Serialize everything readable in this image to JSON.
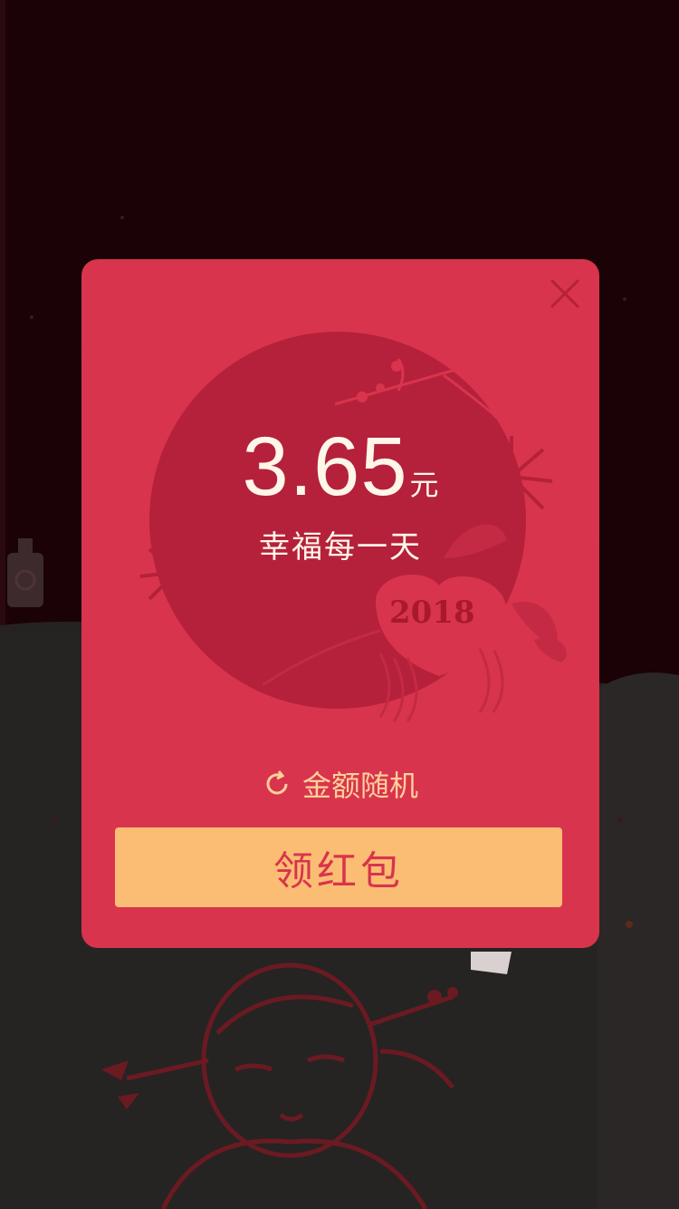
{
  "red_packet": {
    "amount": "3.65",
    "currency_unit": "元",
    "blessing": "幸福每一天",
    "year": "2018",
    "random_label": "金额随机",
    "claim_button_label": "领红包",
    "close_icon": "close-icon",
    "random_icon": "refresh-icon"
  },
  "colors": {
    "overlay_background": "#1a0206",
    "card_background": "#d9344d",
    "circle": "#b5213a",
    "amount_text": "#fff6ea",
    "random_text": "#fcd09b",
    "button_background": "#fbbd73",
    "button_text": "#d9344d"
  }
}
